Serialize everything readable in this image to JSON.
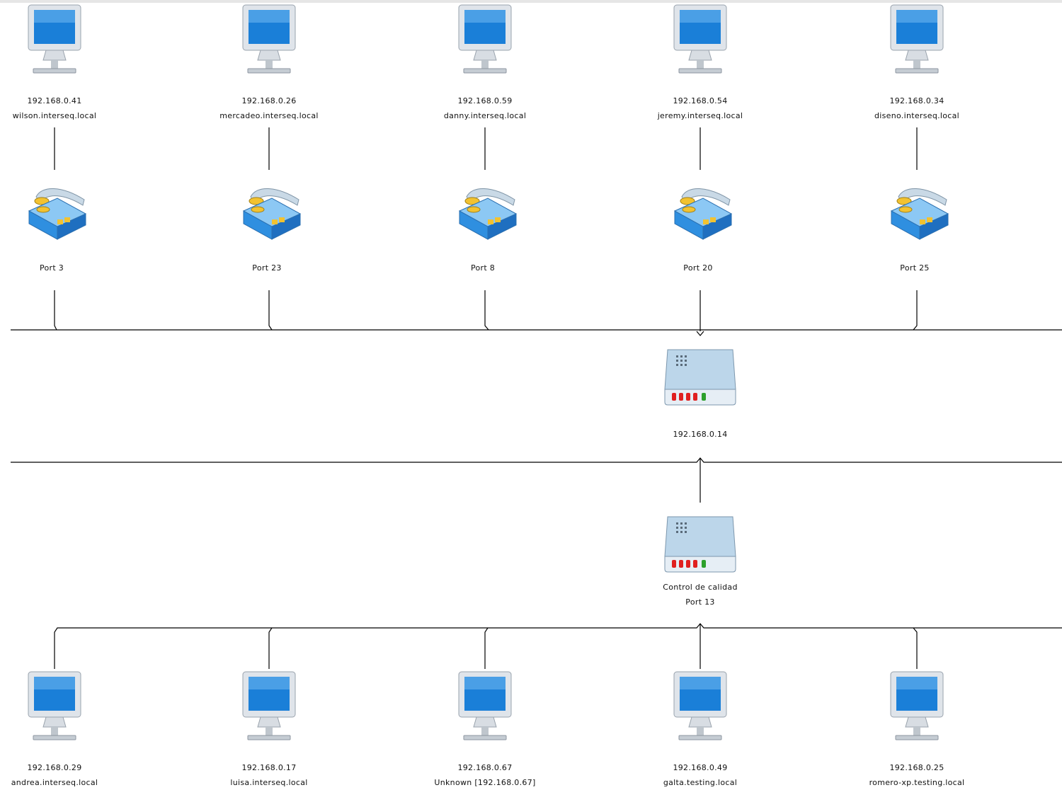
{
  "top_hosts": [
    {
      "ip": "192.168.0.41",
      "hostname": "wilson.interseq.local",
      "port": "Port 3"
    },
    {
      "ip": "192.168.0.26",
      "hostname": "mercadeo.interseq.local",
      "port": "Port 23"
    },
    {
      "ip": "192.168.0.59",
      "hostname": "danny.interseq.local",
      "port": "Port 8"
    },
    {
      "ip": "192.168.0.54",
      "hostname": "jeremy.interseq.local",
      "port": "Port 20"
    },
    {
      "ip": "192.168.0.34",
      "hostname": "diseno.interseq.local",
      "port": "Port 25"
    }
  ],
  "core_switch": {
    "label": "192.168.0.14"
  },
  "sub_switch": {
    "name": "Control de calidad",
    "port": "Port 13"
  },
  "bottom_hosts": [
    {
      "ip": "192.168.0.29",
      "hostname": "andrea.interseq.local"
    },
    {
      "ip": "192.168.0.17",
      "hostname": "luisa.interseq.local"
    },
    {
      "ip": "192.168.0.67",
      "hostname": "Unknown [192.168.0.67]"
    },
    {
      "ip": "192.168.0.49",
      "hostname": "galta.testing.local"
    },
    {
      "ip": "192.168.0.25",
      "hostname": "romero-xp.testing.local"
    }
  ],
  "icons": {
    "host": "desktop-computer-icon",
    "port": "network-port-icon",
    "switch": "network-switch-icon"
  },
  "colors": {
    "screen": "#1a7fd8",
    "device_body": "#bcd6ea",
    "port_body": "#3f9be3",
    "led_red": "#e02020",
    "led_green": "#2ca02c",
    "wire": "#000000"
  }
}
